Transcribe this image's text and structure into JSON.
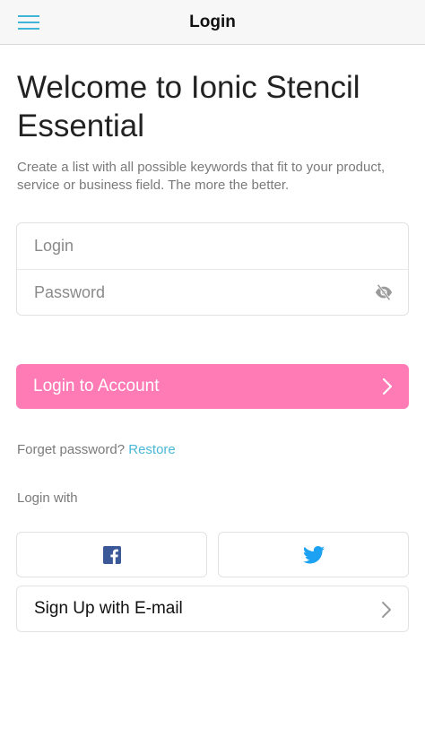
{
  "header": {
    "title": "Login",
    "menu_icon": "hamburger-menu-icon",
    "accent_color": "#3fb6d8"
  },
  "intro": {
    "title": "Welcome to Ionic Stencil Essential",
    "subtitle": "Create a list with all possible keywords that fit to your product, service or business field. The more the better."
  },
  "form": {
    "login_placeholder": "Login",
    "login_value": "",
    "password_placeholder": "Password",
    "password_value": "",
    "password_toggle_icon": "eye-off-icon"
  },
  "login_button": {
    "label": "Login to Account",
    "color": "#ff7bb5",
    "icon": "chevron-right-icon"
  },
  "forget": {
    "text": "Forget password?",
    "link": "Restore",
    "link_color": "#4ab8d6"
  },
  "social": {
    "label": "Login with",
    "facebook_icon": "facebook-icon",
    "facebook_color": "#3b5998",
    "twitter_icon": "twitter-icon",
    "twitter_color": "#1da1f2"
  },
  "signup": {
    "label": "Sign Up with E-mail",
    "icon": "chevron-right-icon"
  }
}
